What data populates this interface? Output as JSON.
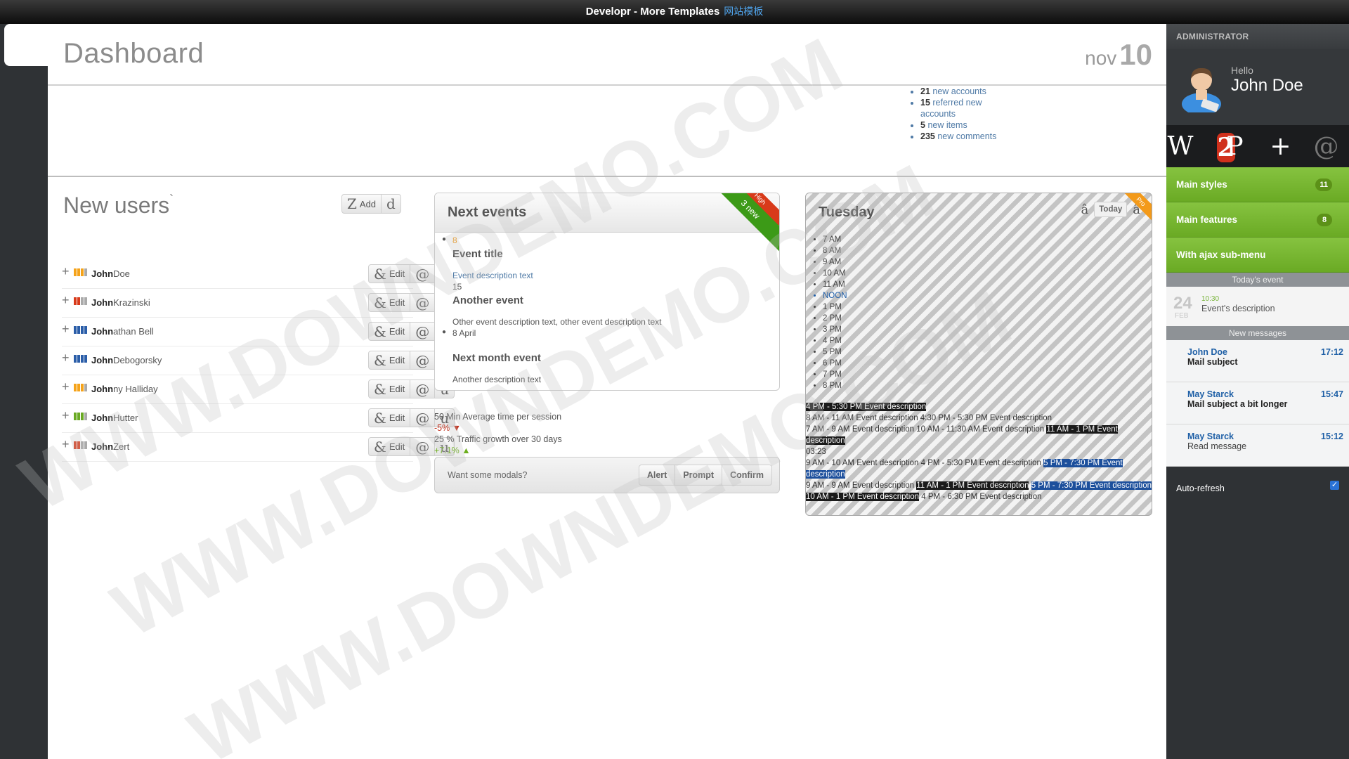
{
  "topbar": {
    "title": "Developr - More Templates",
    "cn": "网站模板"
  },
  "header": {
    "title": "Dashboard",
    "date_month": "nov",
    "date_day": "10"
  },
  "stats": [
    {
      "value": "21",
      "label": "new accounts"
    },
    {
      "value": "15",
      "label": "referred new accounts"
    },
    {
      "value": "5",
      "label": "new items"
    },
    {
      "value": "235",
      "label": "new comments"
    }
  ],
  "new_users": {
    "title": "New users",
    "title_mark": "`",
    "add_glyph": "Z",
    "add_label": "Add",
    "extra_glyph": "d",
    "edit_glyph": "&",
    "edit_label": "Edit",
    "mail_glyph": "@",
    "user_glyph": "u",
    "users": [
      {
        "first": "John",
        "last": "Doe",
        "bars": [
          "#f5a31a",
          "#f5a31a",
          "#f5a31a",
          "#aaaaaa"
        ]
      },
      {
        "first": "John",
        "last": "Krazinski",
        "bars": [
          "#d83a1a",
          "#d83a1a",
          "#aaaaaa",
          "#aaaaaa"
        ]
      },
      {
        "first": "John",
        "last": "athan Bell",
        "bars": [
          "#2a5da8",
          "#2a5da8",
          "#2a5da8",
          "#2a5da8"
        ]
      },
      {
        "first": "John",
        "last": "Debogorsky",
        "bars": [
          "#2a5da8",
          "#2a5da8",
          "#2a5da8",
          "#2a5da8"
        ]
      },
      {
        "first": "John",
        "last": "ny Halliday",
        "bars": [
          "#f5a31a",
          "#f5a31a",
          "#f5a31a",
          "#aaaaaa"
        ]
      },
      {
        "first": "John",
        "last": "Hutter",
        "bars": [
          "#6aaa24",
          "#6aaa24",
          "#6aaa24",
          "#aaaaaa"
        ]
      },
      {
        "first": "John",
        "last": "Zert",
        "bars": [
          "#d83a1a",
          "#d83a1a",
          "#aaaaaa",
          "#aaaaaa"
        ]
      }
    ]
  },
  "next_events": {
    "title": "Next events",
    "ribbon": "3 new",
    "ribbon_small": "High",
    "items": [
      {
        "date": "8",
        "title": "Event title",
        "desc": "Event description text"
      },
      {
        "date": "15",
        "title": "Another event",
        "desc": "Other event description text, other event description text"
      },
      {
        "date": "8 April",
        "title": "Next month event",
        "desc": "Another description text"
      }
    ]
  },
  "session_stats": {
    "line1": "50 Min Average time per session",
    "delta1": "-5%",
    "line2": "25 % Traffic growth over 30 days",
    "delta2": "+7.1%"
  },
  "modals": {
    "label": "Want some modals?",
    "buttons": [
      "Alert",
      "Prompt",
      "Confirm"
    ]
  },
  "calendar": {
    "title": "Tuesday",
    "today_label": "Today",
    "prev_glyph": "â",
    "next_glyph": "â",
    "corner": "Pro",
    "hours": [
      "7 AM",
      "8 AM",
      "9 AM",
      "10 AM",
      "11 AM",
      "NOON",
      "1 PM",
      "2 PM",
      "3 PM",
      "4 PM",
      "5 PM",
      "6 PM",
      "7 PM",
      "8 PM"
    ],
    "events": [
      [
        {
          "t": "4 PM - 5:30 PM Event description",
          "s": "d"
        }
      ],
      [
        {
          "t": "8 AM - 11 AM Event description 4:30 PM - 5:30 PM Event description",
          "s": ""
        }
      ],
      [
        {
          "t": "7 AM - 9 AM Event description 10 AM - 11:30 AM Event description ",
          "s": ""
        },
        {
          "t": "11 AM - 1 PM Event description",
          "s": "d"
        }
      ],
      [
        {
          "t": "03:23",
          "s": ""
        }
      ],
      [
        {
          "t": "9 AM - 10 AM Event description 4 PM - 5:30 PM Event description ",
          "s": ""
        },
        {
          "t": "5 PM - 7:30 PM Event description",
          "s": "b"
        }
      ],
      [
        {
          "t": "9 AM - 9 AM Event description ",
          "s": ""
        },
        {
          "t": "11 AM - 1 PM Event description",
          "s": "d"
        },
        {
          "t": " ",
          "s": ""
        },
        {
          "t": "5 PM - 7:30 PM Event description",
          "s": "b"
        }
      ],
      [
        {
          "t": "10 AM - 1 PM Event description",
          "s": "d"
        },
        {
          "t": " 4 PM - 6:30 PM Event description",
          "s": ""
        }
      ]
    ]
  },
  "sidebar": {
    "admin_label": "ADMINISTRATOR",
    "hello": "Hello",
    "user_name": "John Doe",
    "icons": [
      "W",
      "P",
      "+",
      "@"
    ],
    "icon_badge": "2",
    "menu": [
      {
        "label": "Main styles",
        "count": "11"
      },
      {
        "label": "Main features",
        "count": "8"
      },
      {
        "label": "With ajax sub-menu",
        "count": ""
      }
    ],
    "today_event_head": "Today's event",
    "today_event": {
      "day": "24",
      "month": "FEB",
      "time": "10:30",
      "desc": "Event's description"
    },
    "messages_head": "New messages",
    "messages": [
      {
        "from": "John Doe",
        "subject": "Mail subject",
        "time": "17:12",
        "unread": true
      },
      {
        "from": "May Starck",
        "subject": "Mail subject a bit longer",
        "time": "15:47",
        "unread": true
      },
      {
        "from": "May Starck",
        "subject": "Read message",
        "time": "15:12",
        "unread": false
      }
    ],
    "auto_refresh": "Auto-refresh"
  },
  "watermark": "WWW.DOWNDEMO.COM",
  "colors": {
    "accent_green": "#6aaa24",
    "link_blue": "#1e5fa6",
    "danger_red": "#d83a1a",
    "warning_orange": "#f39a1a"
  }
}
